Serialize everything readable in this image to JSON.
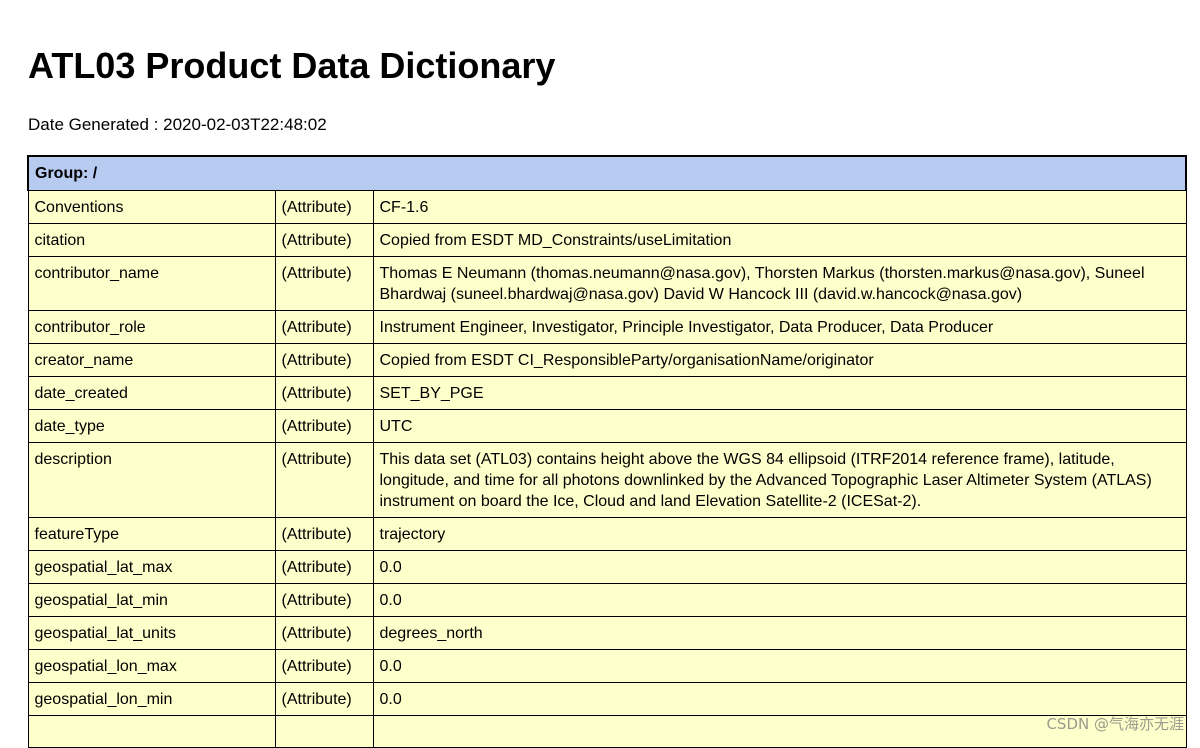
{
  "title": "ATL03 Product Data Dictionary",
  "date_generated": "Date Generated : 2020-02-03T22:48:02",
  "group_label": "Group: /",
  "rows": [
    {
      "name": "Conventions",
      "type": "(Attribute)",
      "value": "CF-1.6"
    },
    {
      "name": "citation",
      "type": "(Attribute)",
      "value": "Copied from ESDT MD_Constraints/useLimitation"
    },
    {
      "name": "contributor_name",
      "type": "(Attribute)",
      "value": "Thomas E Neumann (thomas.neumann@nasa.gov), Thorsten Markus (thorsten.markus@nasa.gov), Suneel Bhardwaj (suneel.bhardwaj@nasa.gov) David W Hancock III (david.w.hancock@nasa.gov)"
    },
    {
      "name": "contributor_role",
      "type": "(Attribute)",
      "value": "Instrument Engineer, Investigator, Principle Investigator, Data Producer, Data Producer"
    },
    {
      "name": "creator_name",
      "type": "(Attribute)",
      "value": "Copied from ESDT CI_ResponsibleParty/organisationName/originator"
    },
    {
      "name": "date_created",
      "type": "(Attribute)",
      "value": "SET_BY_PGE"
    },
    {
      "name": "date_type",
      "type": "(Attribute)",
      "value": "UTC"
    },
    {
      "name": "description",
      "type": "(Attribute)",
      "value": "This data set (ATL03) contains height above the WGS 84 ellipsoid (ITRF2014 reference frame), latitude, longitude, and time for all photons downlinked by the Advanced Topographic Laser Altimeter System (ATLAS) instrument on board the Ice, Cloud and land Elevation Satellite-2 (ICESat-2)."
    },
    {
      "name": "featureType",
      "type": "(Attribute)",
      "value": "trajectory"
    },
    {
      "name": "geospatial_lat_max",
      "type": "(Attribute)",
      "value": "0.0"
    },
    {
      "name": "geospatial_lat_min",
      "type": "(Attribute)",
      "value": "0.0"
    },
    {
      "name": "geospatial_lat_units",
      "type": "(Attribute)",
      "value": "degrees_north"
    },
    {
      "name": "geospatial_lon_max",
      "type": "(Attribute)",
      "value": "0.0"
    },
    {
      "name": "geospatial_lon_min",
      "type": "(Attribute)",
      "value": "0.0"
    }
  ],
  "watermark": "CSDN @气海亦无涯",
  "colors": {
    "group_header": "#b7cbf0",
    "row_background": "#ffffcc",
    "border": "#000000"
  }
}
